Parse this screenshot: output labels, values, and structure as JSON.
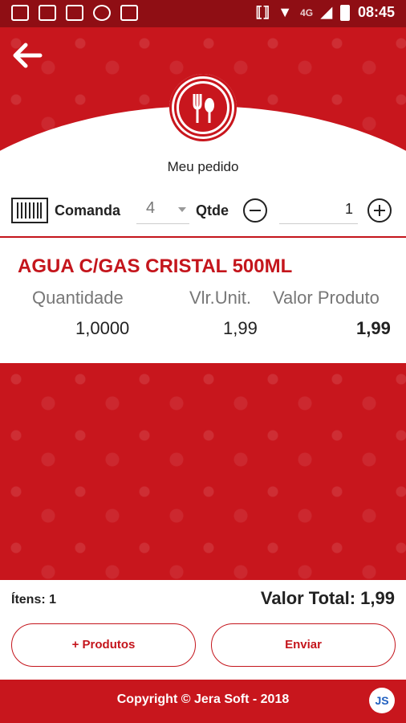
{
  "status_bar": {
    "time": "08:45",
    "network": "4G",
    "left_icons": [
      "message-icon",
      "image-icon",
      "twitch-icon",
      "whatsapp-icon",
      "tv-icon"
    ]
  },
  "header": {
    "title": "Meu pedido"
  },
  "order_controls": {
    "comanda_label": "Comanda",
    "comanda_value": "4",
    "qtde_label": "Qtde",
    "qtde_value": "1"
  },
  "product": {
    "name": "AGUA C/GAS CRISTAL 500ML",
    "headers": {
      "quantity": "Quantidade",
      "unit_value": "Vlr.Unit.",
      "product_value": "Valor Produto"
    },
    "values": {
      "quantity": "1,0000",
      "unit_value": "1,99",
      "product_value": "1,99"
    }
  },
  "summary": {
    "items": "Ítens: 1",
    "total": "Valor Total: 1,99"
  },
  "actions": {
    "more_products": "+ Produtos",
    "send": "Enviar"
  },
  "footer": {
    "copyright": "Copyright © Jera Soft - 2018",
    "brand_initials": "JS"
  },
  "colors": {
    "primary_red": "#c8161d",
    "dark_red": "#8f0e14"
  }
}
